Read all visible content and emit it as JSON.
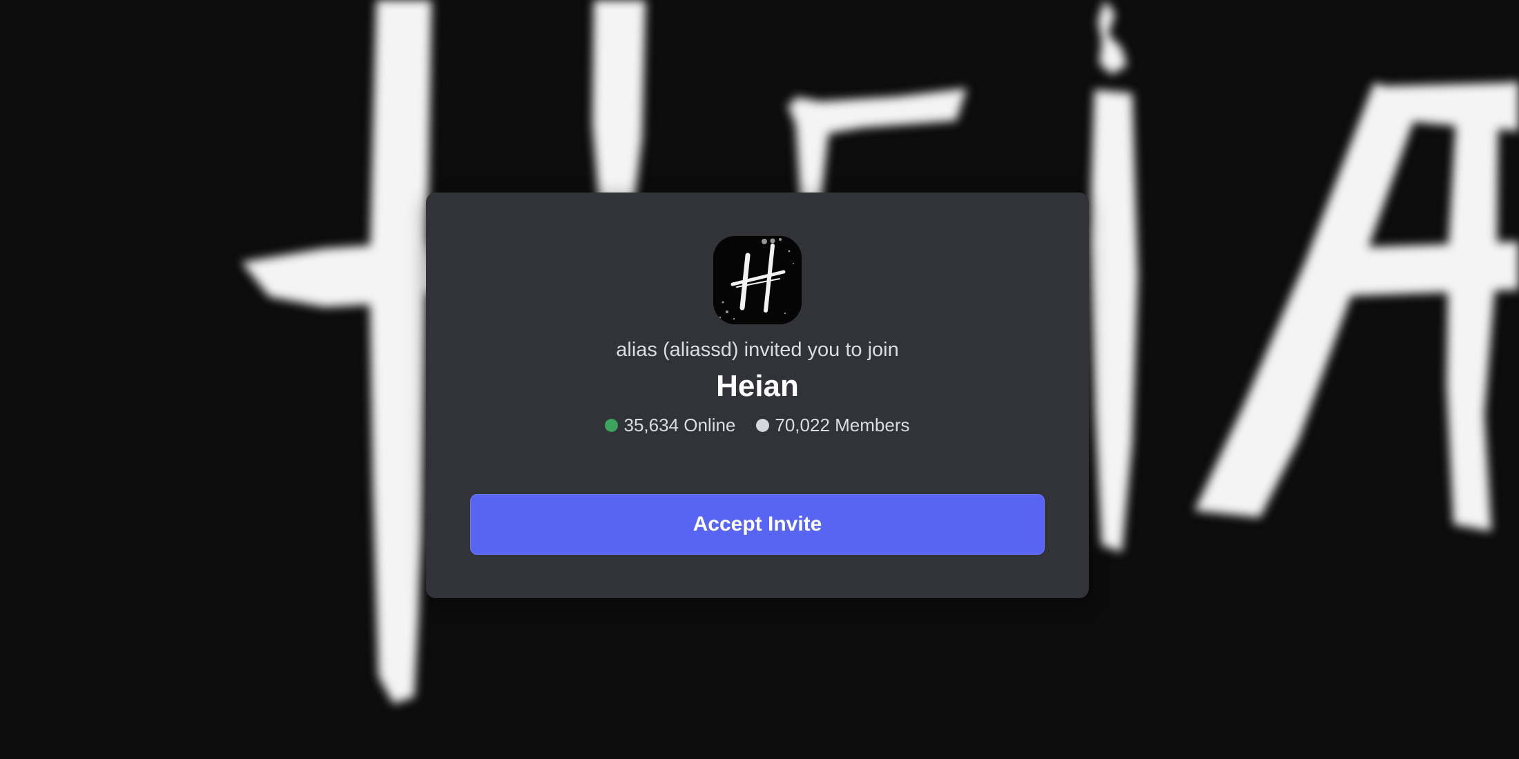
{
  "invite": {
    "inviter_text": "alias (aliassd) invited you to join",
    "server_name": "Heian",
    "online_count": "35,634 Online",
    "member_count": "70,022 Members",
    "accept_label": "Accept Invite"
  },
  "server_icon": {
    "icon": "heian-h-logo",
    "logo_text": "H"
  },
  "background": {
    "art_text": "HEIAN"
  },
  "colors": {
    "page_background": "#0c0c0d",
    "card_background": "#313338",
    "accent": "#5865f2",
    "online": "#3ba55d",
    "members": "#d4d7dc"
  }
}
